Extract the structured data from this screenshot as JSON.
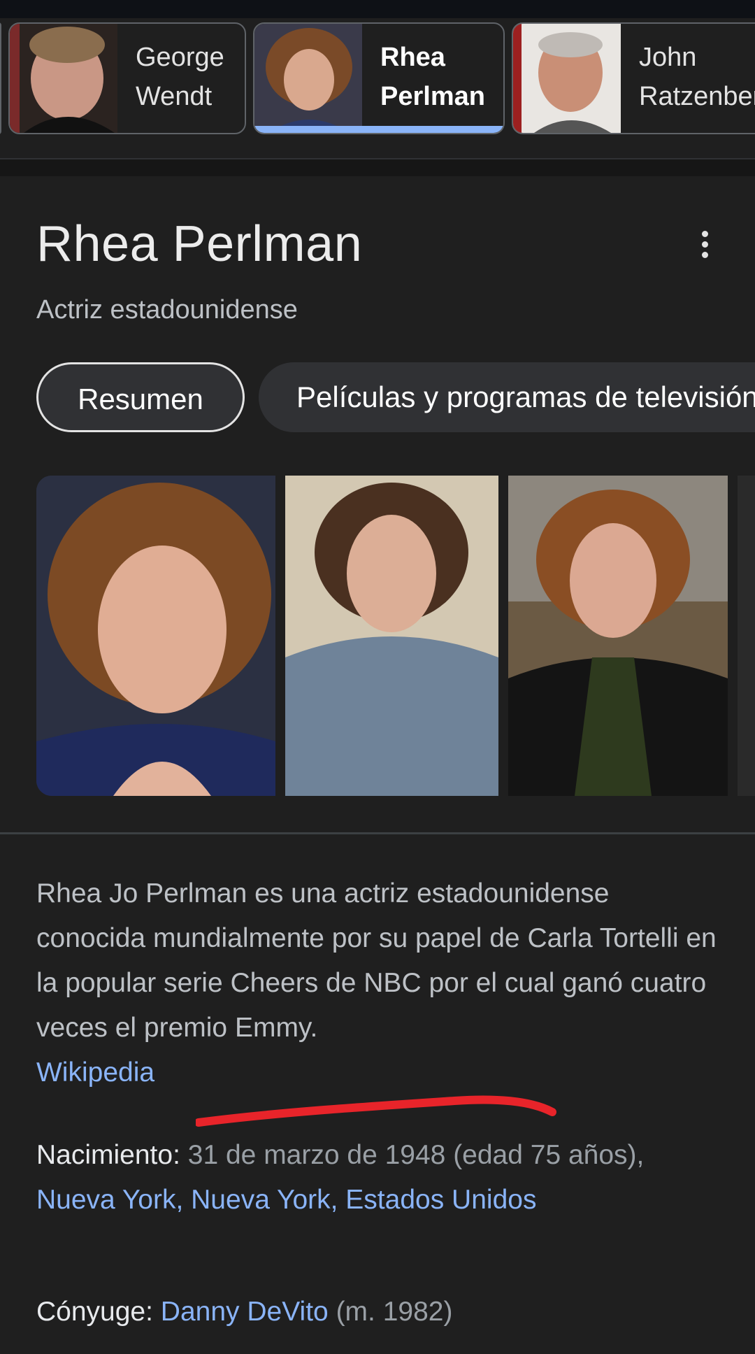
{
  "carousel": {
    "people": [
      {
        "name": "George\nWendt",
        "active": false
      },
      {
        "name": "Rhea\nPerlman",
        "active": true
      },
      {
        "name": "John\nRatzenberger",
        "active": false
      }
    ]
  },
  "entity": {
    "title": "Rhea Perlman",
    "subtitle": "Actriz estadounidense"
  },
  "tabs": {
    "summary": "Resumen",
    "movies": "Películas y programas de televisión"
  },
  "description": {
    "text": "Rhea Jo Perlman es una actriz estadounidense conocida mundialmente por su papel de Carla Tortelli en la popular serie Cheers de NBC por el cual ganó cuatro veces el premio Emmy.",
    "source": "Wikipedia"
  },
  "facts": {
    "birth_label": "Nacimiento:",
    "birth_value": " 31 de marzo de 1948 (edad 75 años), ",
    "birth_place": "Nueva York, Nueva York, Estados Unidos",
    "spouse_label": "Cónyuge:",
    "spouse_name": "Danny DeVito",
    "spouse_years": " (m. 1982)"
  },
  "colors": {
    "background": "#1f1f1f",
    "link": "#8ab4f8",
    "active_underline": "#8ab4f8",
    "annotation_red": "#e8242a"
  }
}
